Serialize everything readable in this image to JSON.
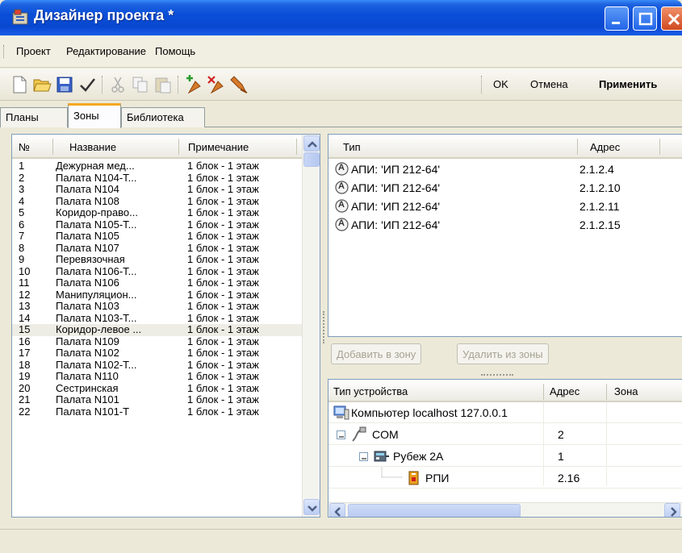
{
  "window": {
    "title": "Дизайнер проекта *",
    "colors": {
      "titlebar": "#0a4fd8",
      "accent_tab": "#f5a623",
      "selection": "#eeede5"
    }
  },
  "menu": {
    "items": [
      "Проект",
      "Редактирование",
      "Помощь"
    ]
  },
  "toolbar": {
    "icons": [
      "new-file-icon",
      "open-folder-icon",
      "save-icon",
      "check-icon",
      "cut-icon",
      "copy-icon",
      "paste-icon",
      "add-device-icon",
      "remove-device-icon",
      "move-device-icon"
    ],
    "ok_label": "OK",
    "cancel_label": "Отмена",
    "apply_label": "Применить"
  },
  "tabs": [
    "Планы",
    "Зоны",
    "Библиотека"
  ],
  "zones": {
    "columns": [
      "№",
      "Название",
      "Примечание"
    ],
    "selected_index": 14,
    "rows": [
      {
        "num": "1",
        "name": "Дежурная мед...",
        "note": "1 блок - 1 этаж"
      },
      {
        "num": "2",
        "name": "Палата N104-Т...",
        "note": "1 блок - 1 этаж"
      },
      {
        "num": "3",
        "name": "Палата N104",
        "note": "1 блок - 1 этаж"
      },
      {
        "num": "4",
        "name": "Палата N108",
        "note": "1 блок - 1 этаж"
      },
      {
        "num": "5",
        "name": "Коридор-право...",
        "note": "1 блок - 1 этаж"
      },
      {
        "num": "6",
        "name": "Палата N105-Т...",
        "note": "1 блок - 1 этаж"
      },
      {
        "num": "7",
        "name": "Палата N105",
        "note": "1 блок - 1 этаж"
      },
      {
        "num": "8",
        "name": "Палата N107",
        "note": "1 блок - 1 этаж"
      },
      {
        "num": "9",
        "name": "Перевязочная",
        "note": "1 блок - 1 этаж"
      },
      {
        "num": "10",
        "name": "Палата N106-Т...",
        "note": "1 блок - 1 этаж"
      },
      {
        "num": "11",
        "name": "Палата N106",
        "note": "1 блок - 1 этаж"
      },
      {
        "num": "12",
        "name": "Манипуляцион...",
        "note": "1 блок - 1 этаж"
      },
      {
        "num": "13",
        "name": "Палата N103",
        "note": "1 блок - 1 этаж"
      },
      {
        "num": "14",
        "name": "Палата N103-Т...",
        "note": "1 блок - 1 этаж"
      },
      {
        "num": "15",
        "name": "Коридор-левое ...",
        "note": "1 блок - 1 этаж"
      },
      {
        "num": "16",
        "name": "Палата N109",
        "note": "1 блок - 1 этаж"
      },
      {
        "num": "17",
        "name": "Палата N102",
        "note": "1 блок - 1 этаж"
      },
      {
        "num": "18",
        "name": "Палата N102-Т...",
        "note": "1 блок - 1 этаж"
      },
      {
        "num": "19",
        "name": "Палата N110",
        "note": "1 блок - 1 этаж"
      },
      {
        "num": "20",
        "name": "Сестринская",
        "note": "1 блок - 1 этаж"
      },
      {
        "num": "21",
        "name": "Палата N101",
        "note": "1 блок - 1 этаж"
      },
      {
        "num": "22",
        "name": "Палата N101-Т",
        "note": "1 блок - 1 этаж"
      }
    ]
  },
  "zone_devices": {
    "columns": [
      "Тип",
      "Адрес"
    ],
    "badge": "А",
    "rows": [
      {
        "type": "АПИ: 'ИП 212-64'",
        "addr": "2.1.2.4"
      },
      {
        "type": "АПИ: 'ИП 212-64'",
        "addr": "2.1.2.10"
      },
      {
        "type": "АПИ: 'ИП 212-64'",
        "addr": "2.1.2.11"
      },
      {
        "type": "АПИ: 'ИП 212-64'",
        "addr": "2.1.2.15"
      }
    ]
  },
  "buttons": {
    "add_to_zone": "Добавить в зону",
    "remove_from_zone": "Удалить из зоны"
  },
  "device_tree": {
    "columns": [
      "Тип устройства",
      "Адрес",
      "Зона"
    ],
    "rows": [
      {
        "label": "Компьютер localhost 127.0.0.1",
        "addr": "",
        "icon": "computer-icon"
      },
      {
        "label": "COM",
        "addr": "2",
        "icon": "com-port-icon"
      },
      {
        "label": "Рубеж 2А",
        "addr": "1",
        "icon": "control-panel-icon"
      },
      {
        "label": "РПИ",
        "addr": "2.16",
        "icon": "rpi-device-icon"
      }
    ]
  }
}
